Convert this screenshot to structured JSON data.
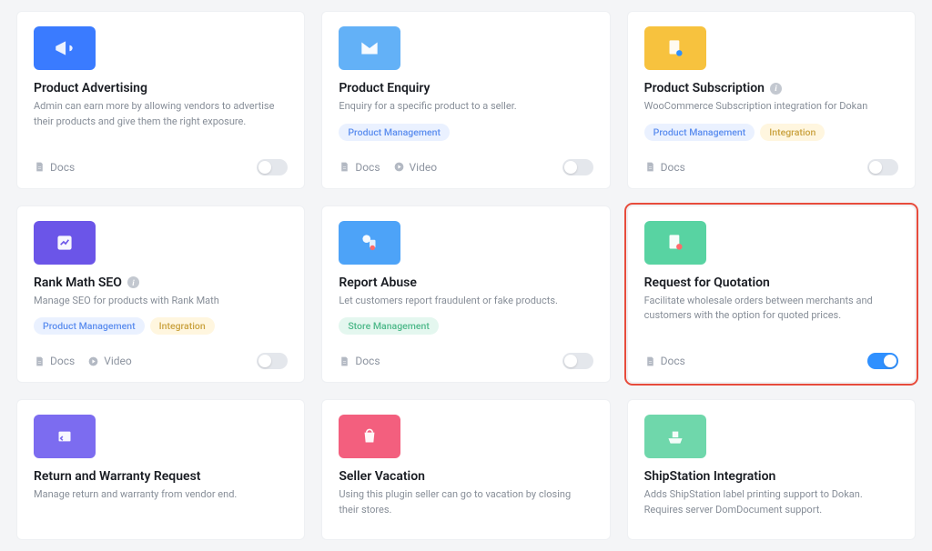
{
  "labels": {
    "docs": "Docs",
    "video": "Video"
  },
  "tags": {
    "product_management": "Product Management",
    "integration": "Integration",
    "store_management": "Store Management"
  },
  "cards": [
    {
      "title": "Product Advertising",
      "desc": "Admin can earn more by allowing vendors to advertise their products and give them the right exposure.",
      "thumb_color": "#3a7bff",
      "icon": "megaphone",
      "tags": [],
      "info": false,
      "docs": true,
      "video": false,
      "toggle_on": false,
      "highlight": false
    },
    {
      "title": "Product Enquiry",
      "desc": "Enquiry for a specific product to a seller.",
      "thumb_color": "#63b1f7",
      "icon": "mail",
      "tags": [
        "product_management"
      ],
      "info": false,
      "docs": true,
      "video": true,
      "toggle_on": false,
      "highlight": false
    },
    {
      "title": "Product Subscription",
      "desc": "WooCommerce Subscription integration for Dokan",
      "thumb_color": "#f7c23e",
      "icon": "refresh",
      "tags": [
        "product_management",
        "integration"
      ],
      "info": true,
      "docs": true,
      "video": false,
      "toggle_on": false,
      "highlight": false
    },
    {
      "title": "Rank Math SEO",
      "desc": "Manage SEO for products with Rank Math",
      "thumb_color": "#6b55e8",
      "icon": "chart",
      "tags": [
        "product_management",
        "integration"
      ],
      "info": true,
      "docs": true,
      "video": true,
      "toggle_on": false,
      "highlight": false
    },
    {
      "title": "Report Abuse",
      "desc": "Let customers report fraudulent or fake products.",
      "thumb_color": "#4da3f8",
      "icon": "flag",
      "tags": [
        "store_management"
      ],
      "info": false,
      "docs": true,
      "video": false,
      "toggle_on": false,
      "highlight": false
    },
    {
      "title": "Request for Quotation",
      "desc": "Facilitate wholesale orders between merchants and customers with the option for quoted prices.",
      "thumb_color": "#58d3a2",
      "icon": "doc",
      "tags": [],
      "info": false,
      "docs": true,
      "video": false,
      "toggle_on": true,
      "highlight": true
    },
    {
      "title": "Return and Warranty Request",
      "desc": "Manage return and warranty from vendor end.",
      "thumb_color": "#7c6cf0",
      "icon": "return",
      "tags": [],
      "info": false,
      "docs": false,
      "video": false,
      "toggle_on": false,
      "highlight": false,
      "short": true
    },
    {
      "title": "Seller Vacation",
      "desc": "Using this plugin seller can go to vacation by closing their stores.",
      "thumb_color": "#f35f7e",
      "icon": "bag",
      "tags": [],
      "info": false,
      "docs": false,
      "video": false,
      "toggle_on": false,
      "highlight": false,
      "short": true
    },
    {
      "title": "ShipStation Integration",
      "desc": "Adds ShipStation label printing support to Dokan. Requires server DomDocument support.",
      "thumb_color": "#6fd7ab",
      "icon": "ship",
      "tags": [],
      "info": false,
      "docs": false,
      "video": false,
      "toggle_on": false,
      "highlight": false,
      "short": true
    }
  ]
}
